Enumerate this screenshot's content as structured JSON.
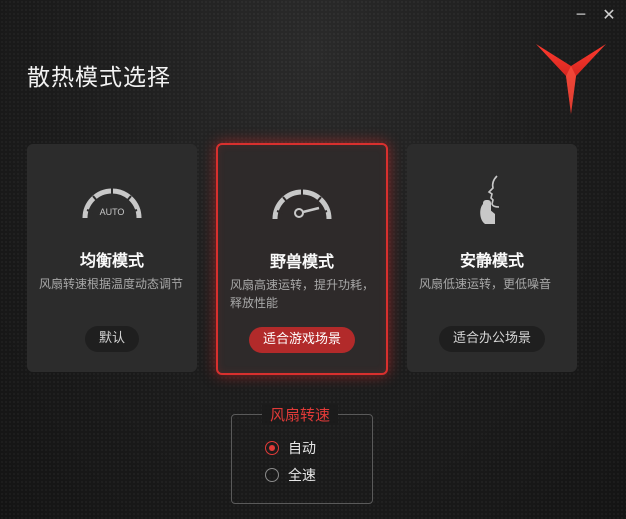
{
  "window": {
    "minimize_glyph": "─",
    "close_glyph": "✕"
  },
  "title": "散热模式选择",
  "colors": {
    "accent": "#d9302e",
    "card_bg": "#2c2c2c",
    "text_muted": "#a8a8a8"
  },
  "modes": [
    {
      "name": "均衡模式",
      "description": "风扇转速根据温度动态调节",
      "button": "默认",
      "icon": "gauge-auto-icon",
      "gauge_text": "AUTO",
      "selected": false
    },
    {
      "name": "野兽模式",
      "description": "风扇高速运转，提升功耗，释放性能",
      "button": "适合游戏场景",
      "icon": "gauge-high-icon",
      "selected": true
    },
    {
      "name": "安静模式",
      "description": "风扇低速运转，更低噪音",
      "button": "适合办公场景",
      "icon": "quiet-face-icon",
      "selected": false
    }
  ],
  "fan_speed": {
    "label": "风扇转速",
    "options": [
      {
        "label": "自动",
        "selected": true
      },
      {
        "label": "全速",
        "selected": false
      }
    ]
  }
}
